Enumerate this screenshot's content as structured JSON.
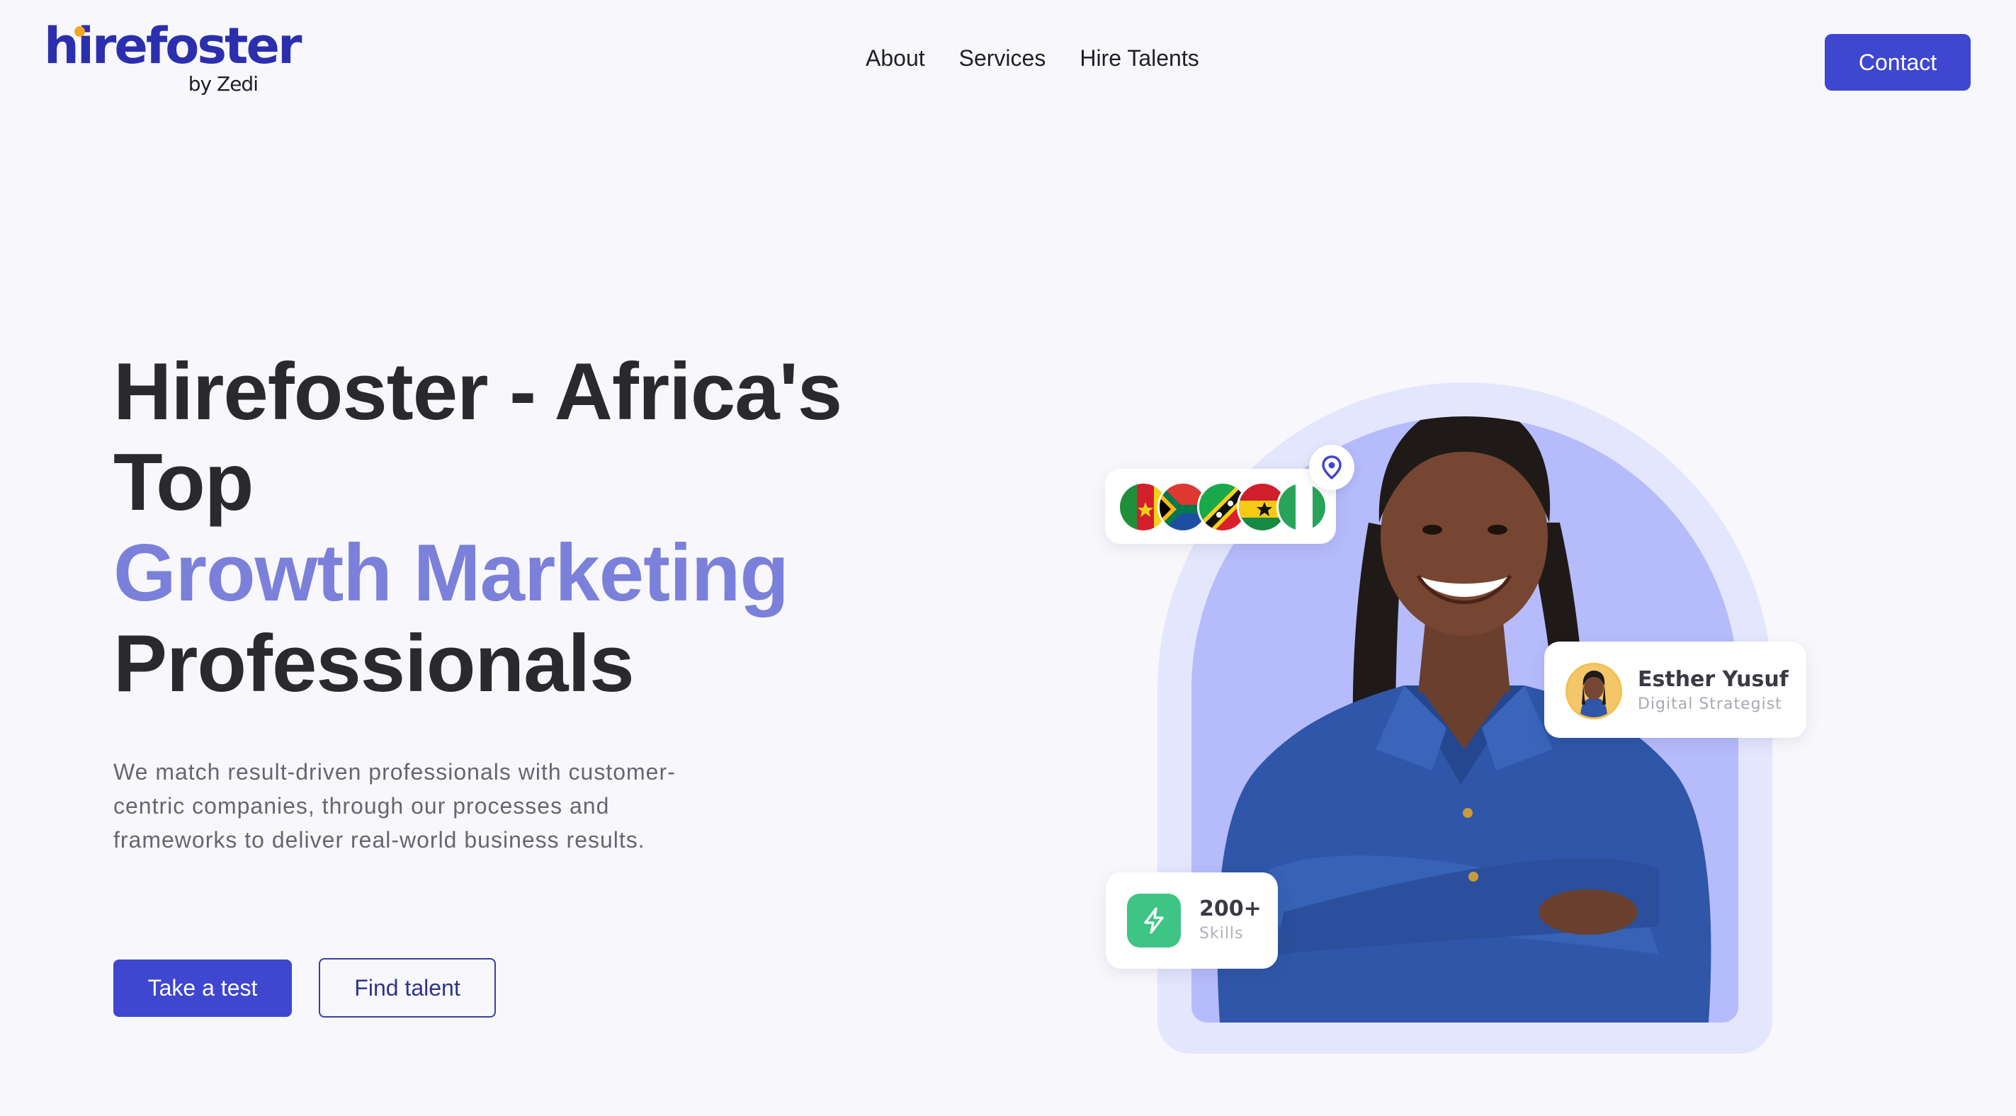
{
  "brand": {
    "name": "hirefoster",
    "sub": "by Zedi",
    "primary_color": "#3f46cf",
    "logo_color": "#2b2fae",
    "accent_dot_color": "#f5a623"
  },
  "nav": {
    "items": [
      {
        "label": "About"
      },
      {
        "label": "Services"
      },
      {
        "label": "Hire Talents"
      }
    ],
    "contact_label": "Contact"
  },
  "hero": {
    "title_line1": "Hirefoster - Africa's",
    "title_line2": "Top",
    "title_accent": "Growth Marketing",
    "title_line4": "Professionals",
    "accent_color": "#7b80da",
    "description": "We match result-driven professionals with customer-centric companies, through our processes and frameworks to deliver real-world business results.",
    "primary_cta": "Take a test",
    "secondary_cta": "Find talent"
  },
  "visual": {
    "flags": [
      "cameroon-flag",
      "south-africa-flag",
      "saint-kitts-flag",
      "ghana-flag",
      "nigeria-flag"
    ],
    "pin_icon": "location-pin-icon",
    "profile": {
      "name": "Esther Yusuf",
      "role": "Digital Strategist"
    },
    "skills": {
      "value": "200+",
      "label": "Skills",
      "icon": "lightning-icon",
      "icon_color": "#3ec485"
    },
    "arch_outer_color": "#e4e6fd",
    "arch_inner_color": "#b6bbfb"
  }
}
